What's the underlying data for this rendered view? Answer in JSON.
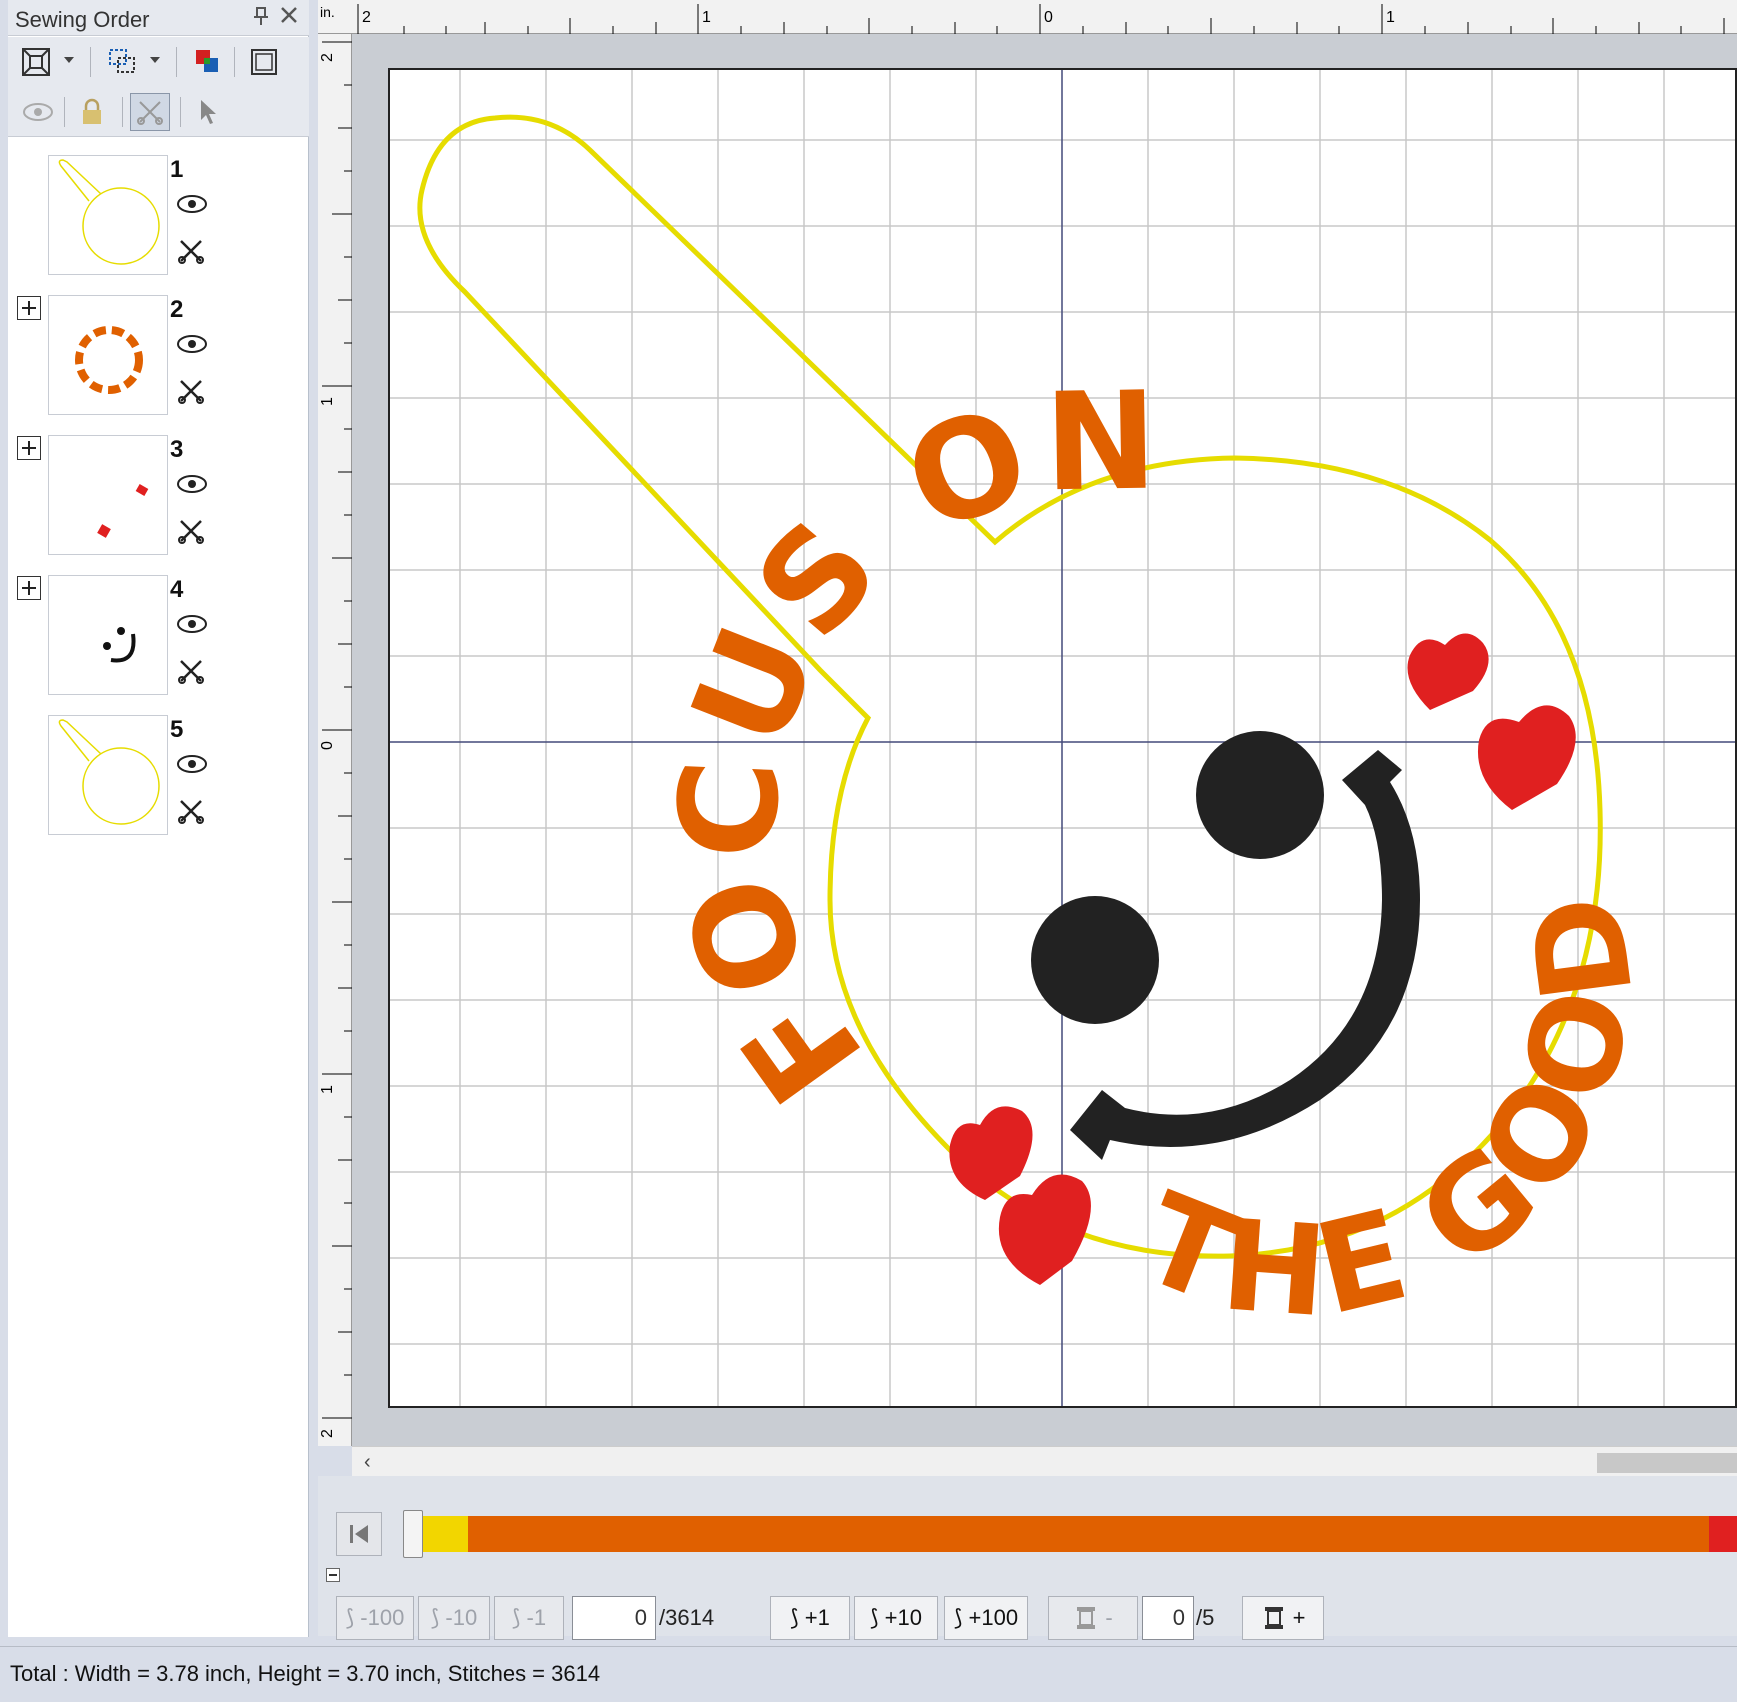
{
  "panel": {
    "title": "Sewing Order",
    "items": [
      {
        "num": "1",
        "expand": false
      },
      {
        "num": "2",
        "expand": true
      },
      {
        "num": "3",
        "expand": true
      },
      {
        "num": "4",
        "expand": true
      },
      {
        "num": "5",
        "expand": false
      }
    ]
  },
  "ruler": {
    "unit": "in.",
    "top_labels": [
      "2",
      "1",
      "0",
      "1"
    ],
    "left_labels": [
      "2",
      "1",
      "0",
      "1",
      "2"
    ]
  },
  "design": {
    "text_top": "FOCUS ON",
    "text_bottom": "THE GOOD",
    "colors": {
      "outline": "#e6dc00",
      "text": "#e06000",
      "hearts": "#e02020",
      "face": "#222222"
    }
  },
  "stitch": {
    "btn_minus100": "-100",
    "btn_minus10": "-10",
    "btn_minus1": "-1",
    "current_stitch": "0",
    "total_stitches": "/3614",
    "btn_plus1": "+1",
    "btn_plus10": "+10",
    "btn_plus100": "+100",
    "color_minus": "-",
    "current_color": "0",
    "total_colors": "/5",
    "color_plus": "+",
    "progress_colors": [
      "#f2d600",
      "#e06000",
      "#e02020"
    ],
    "progress_fraction": 0
  },
  "status": {
    "text": "Total : Width = 3.78 inch, Height = 3.70 inch, Stitches = 3614"
  }
}
